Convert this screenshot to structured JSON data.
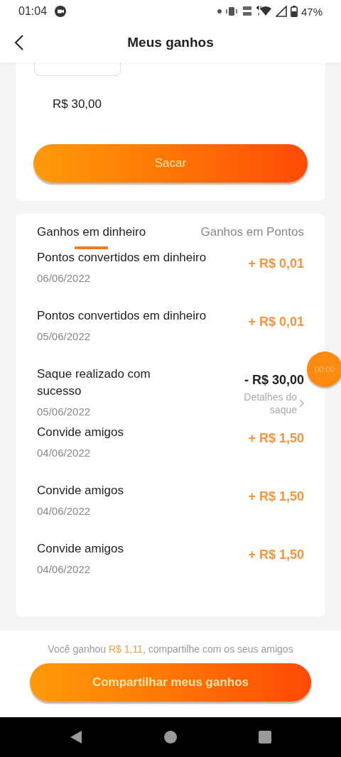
{
  "status_bar": {
    "time": "01:04",
    "battery": "47%"
  },
  "header": {
    "title": "Meus ganhos"
  },
  "withdraw": {
    "amount": "R$ 30,00",
    "button": "Sacar"
  },
  "tabs": [
    {
      "label": "Ganhos em dinheiro",
      "selected": true
    },
    {
      "label": "Ganhos em Pontos",
      "selected": false
    }
  ],
  "transactions": [
    {
      "title": "Pontos convertidos em dinheiro",
      "date": "06/06/2022",
      "amount": "+ R$ 0,01",
      "kind": "credit"
    },
    {
      "title": "Pontos convertidos em dinheiro",
      "date": "05/06/2022",
      "amount": "+ R$ 0,01",
      "kind": "credit"
    },
    {
      "title": "Saque realizado com sucesso",
      "date": "05/06/2022",
      "amount": "- R$ 30,00",
      "kind": "debit",
      "link": "Detalhes do saque"
    },
    {
      "title": "Convide amigos",
      "date": "04/06/2022",
      "amount": "+ R$ 1,50",
      "kind": "credit"
    },
    {
      "title": "Convide amigos",
      "date": "04/06/2022",
      "amount": "+ R$ 1,50",
      "kind": "credit"
    },
    {
      "title": "Convide amigos",
      "date": "04/06/2022",
      "amount": "+ R$ 1,50",
      "kind": "credit"
    }
  ],
  "timer": "00:00",
  "footer": {
    "prompt_before": "Você ganhou ",
    "prompt_amount": "R$ 1,11",
    "prompt_after": ", compartilhe com os seus amigos",
    "button": "Compartilhar meus ganhos"
  }
}
